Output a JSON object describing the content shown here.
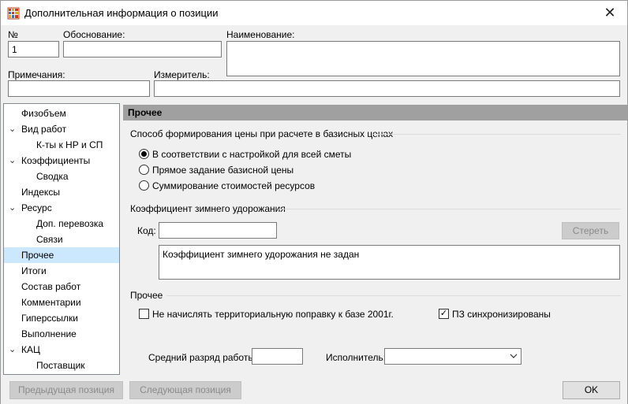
{
  "window": {
    "title": "Дополнительная информация о позиции",
    "close_glyph": "✕"
  },
  "top_fields": {
    "number_label": "№",
    "number_value": "1",
    "basis_label": "Обоснование:",
    "basis_value": "",
    "name_label": "Наименование:",
    "name_value": "",
    "notes_label": "Примечания:",
    "notes_value": "",
    "unit_label": "Измеритель:",
    "unit_value": ""
  },
  "tree": {
    "items": [
      {
        "label": "Физобъем",
        "level": 0,
        "arrow": ""
      },
      {
        "label": "Вид работ",
        "level": 0,
        "arrow": "⌄"
      },
      {
        "label": "К-ты к НР и СП",
        "level": 1,
        "arrow": ""
      },
      {
        "label": "Коэффициенты",
        "level": 0,
        "arrow": "⌄"
      },
      {
        "label": "Сводка",
        "level": 1,
        "arrow": ""
      },
      {
        "label": "Индексы",
        "level": 0,
        "arrow": ""
      },
      {
        "label": "Ресурс",
        "level": 0,
        "arrow": "⌄"
      },
      {
        "label": "Доп. перевозка",
        "level": 1,
        "arrow": ""
      },
      {
        "label": "Связи",
        "level": 1,
        "arrow": ""
      },
      {
        "label": "Прочее",
        "level": 0,
        "arrow": "",
        "selected": true
      },
      {
        "label": "Итоги",
        "level": 0,
        "arrow": ""
      },
      {
        "label": "Состав работ",
        "level": 0,
        "arrow": ""
      },
      {
        "label": "Комментарии",
        "level": 0,
        "arrow": ""
      },
      {
        "label": "Гиперссылки",
        "level": 0,
        "arrow": ""
      },
      {
        "label": "Выполнение",
        "level": 0,
        "arrow": ""
      },
      {
        "label": "КАЦ",
        "level": 0,
        "arrow": "⌄"
      },
      {
        "label": "Поставщик",
        "level": 1,
        "arrow": ""
      }
    ]
  },
  "panel": {
    "header": "Прочее",
    "pricing_group": {
      "title": "Способ формирования цены при расчете в базисных ценах",
      "options": [
        {
          "label": "В соответствии с настройкой для всей сметы",
          "checked": true
        },
        {
          "label": "Прямое задание базисной цены",
          "checked": false
        },
        {
          "label": "Суммирование стоимостей ресурсов",
          "checked": false
        }
      ]
    },
    "winter_group": {
      "title": "Коэффициент зимнего удорожания",
      "code_label": "Код:",
      "code_value": "",
      "clear_button": "Стереть",
      "memo_text": "Коэффициент зимнего удорожания не задан"
    },
    "other_group": {
      "title": "Прочее",
      "no_territorial_label": "Не начислять территориальную поправку к базе 2001г.",
      "no_territorial_checked": false,
      "pz_sync_label": "ПЗ синхронизированы",
      "pz_sync_checked": true,
      "avg_grade_label": "Средний разряд работы:",
      "avg_grade_value": "",
      "executor_label": "Исполнитель:",
      "executor_value": ""
    }
  },
  "footer": {
    "prev_button": "Предыдущая позиция",
    "next_button": "Следующая позиция",
    "ok_button": "OK"
  },
  "colors": {
    "selection": "#cce8ff",
    "section_header": "#a0a0a0"
  }
}
